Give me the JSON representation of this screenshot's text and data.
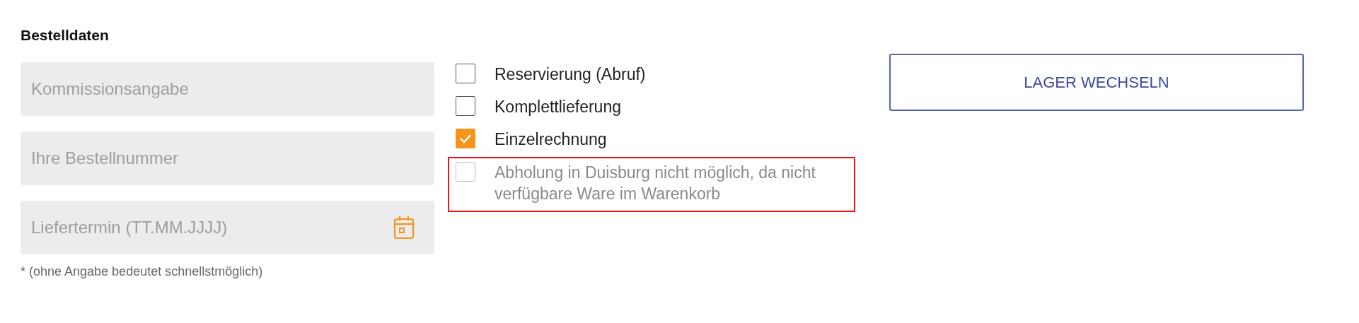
{
  "section": {
    "title": "Bestelldaten"
  },
  "fields": [
    {
      "kind": "text",
      "placeholder": "Kommissionsangabe"
    },
    {
      "kind": "text",
      "placeholder": "Ihre Bestellnummer"
    },
    {
      "kind": "date",
      "placeholder": "Liefertermin (TT.MM.JJJJ)"
    }
  ],
  "footnote": "* (ohne Angabe bedeutet schnellstmöglich)",
  "options": [
    {
      "label": "Reservierung (Abruf)",
      "checked": false,
      "disabled": false,
      "highlighted": false
    },
    {
      "label": "Komplettlieferung",
      "checked": false,
      "disabled": false,
      "highlighted": false
    },
    {
      "label": "Einzelrechnung",
      "checked": true,
      "disabled": false,
      "highlighted": false
    },
    {
      "label": "Abholung in Duisburg nicht möglich, da nicht verfügbare Ware im Warenkorb",
      "checked": false,
      "disabled": true,
      "highlighted": true
    }
  ],
  "buttons": [
    {
      "label": "LAGER WECHSELN"
    }
  ]
}
